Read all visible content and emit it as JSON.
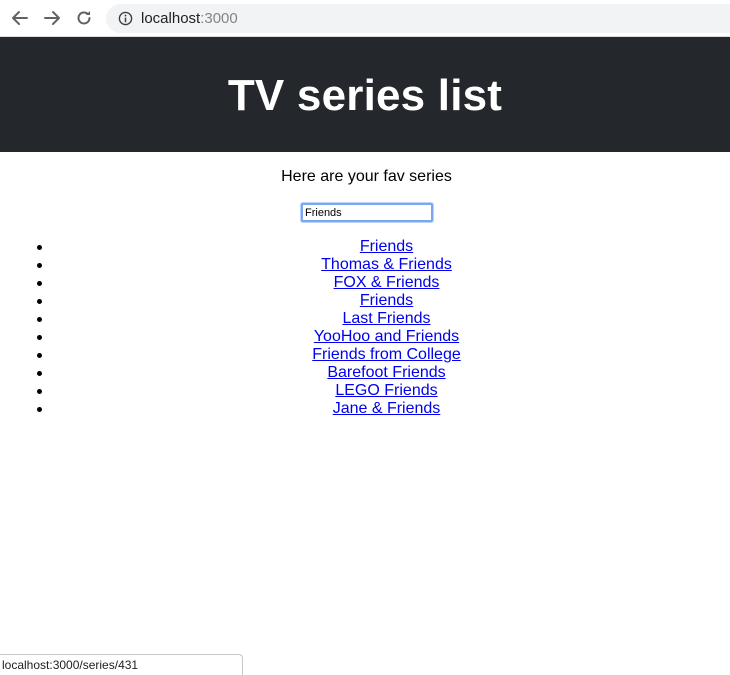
{
  "browser": {
    "url_host": "localhost",
    "url_port": ":3000"
  },
  "header": {
    "title": "TV series list"
  },
  "main": {
    "subtitle": "Here are your fav series",
    "search": {
      "value": "Friends"
    },
    "series": [
      {
        "label": "Friends"
      },
      {
        "label": "Thomas & Friends"
      },
      {
        "label": "FOX & Friends"
      },
      {
        "label": "Friends"
      },
      {
        "label": "Last Friends"
      },
      {
        "label": "YooHoo and Friends"
      },
      {
        "label": "Friends from College"
      },
      {
        "label": "Barefoot Friends"
      },
      {
        "label": "LEGO Friends"
      },
      {
        "label": "Jane & Friends"
      }
    ]
  },
  "status_bar": {
    "text": "localhost:3000/series/431"
  },
  "colors": {
    "header_bg": "#24272b",
    "link": "#0000ee",
    "focus_ring": "#7aa7f0"
  }
}
